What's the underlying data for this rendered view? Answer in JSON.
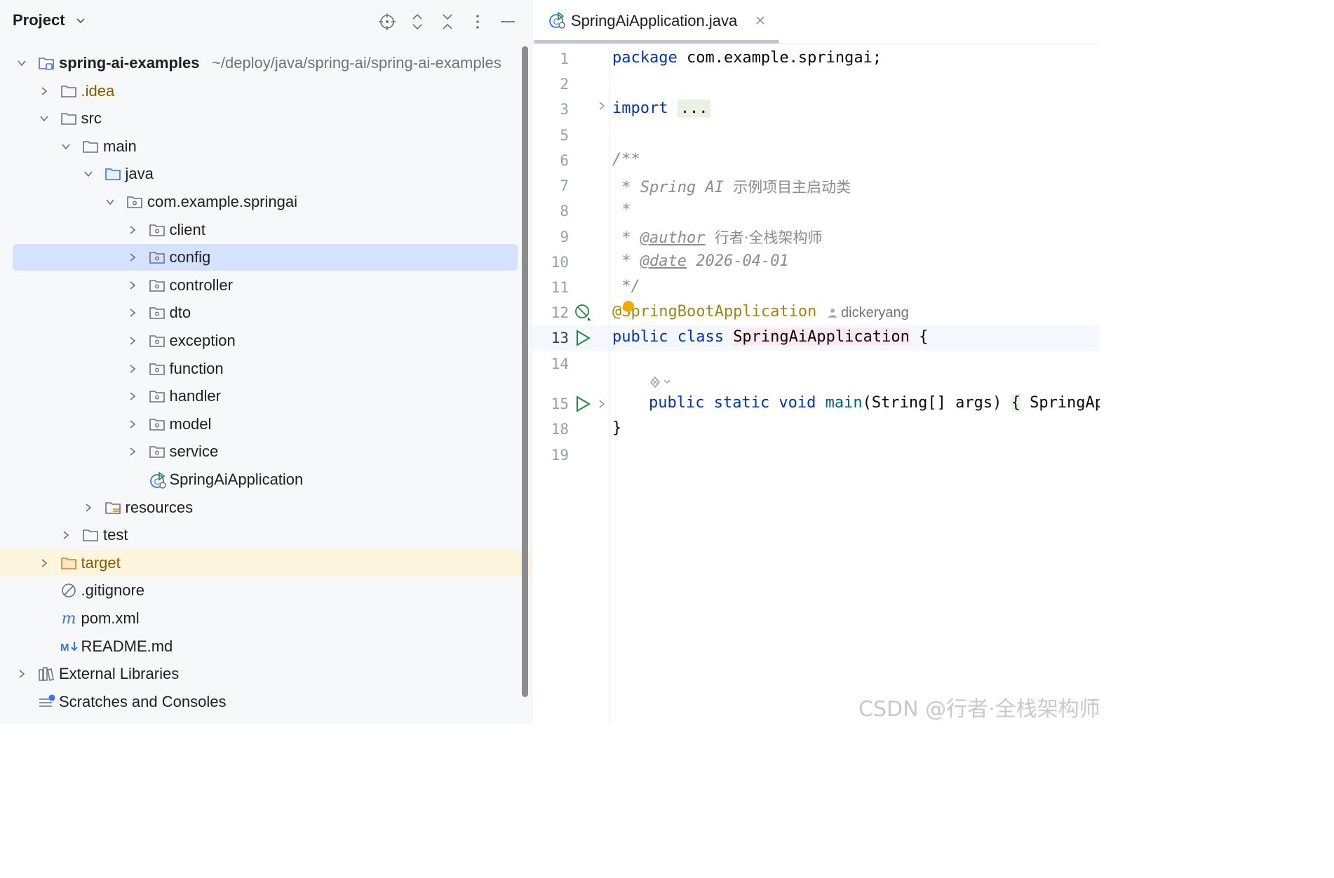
{
  "project_panel": {
    "title": "Project",
    "header_buttons": [
      "locate-icon",
      "expand-all-icon",
      "collapse-all-icon",
      "more-options-icon",
      "hide-panel-icon"
    ],
    "tree": [
      {
        "label": "spring-ai-examples",
        "path": "~/deploy/java/spring-ai/spring-ai-examples",
        "icon": "module-folder-icon",
        "expanded": true
      },
      {
        "label": ".idea",
        "icon": "folder-icon",
        "expanded": false
      },
      {
        "label": "src",
        "icon": "folder-icon",
        "expanded": true
      },
      {
        "label": "main",
        "icon": "folder-icon",
        "expanded": true
      },
      {
        "label": "java",
        "icon": "source-folder-icon",
        "expanded": true
      },
      {
        "label": "com.example.springai",
        "icon": "package-icon",
        "expanded": true
      },
      {
        "label": "client",
        "icon": "package-icon",
        "expanded": false
      },
      {
        "label": "config",
        "icon": "package-icon",
        "expanded": false,
        "selected": true
      },
      {
        "label": "controller",
        "icon": "package-icon",
        "expanded": false
      },
      {
        "label": "dto",
        "icon": "package-icon",
        "expanded": false
      },
      {
        "label": "exception",
        "icon": "package-icon",
        "expanded": false
      },
      {
        "label": "function",
        "icon": "package-icon",
        "expanded": false
      },
      {
        "label": "handler",
        "icon": "package-icon",
        "expanded": false
      },
      {
        "label": "model",
        "icon": "package-icon",
        "expanded": false
      },
      {
        "label": "service",
        "icon": "package-icon",
        "expanded": false
      },
      {
        "label": "SpringAiApplication",
        "icon": "spring-boot-class-icon"
      },
      {
        "label": "resources",
        "icon": "resources-folder-icon",
        "expanded": false
      },
      {
        "label": "test",
        "icon": "folder-icon",
        "expanded": false
      },
      {
        "label": "target",
        "icon": "excluded-folder-icon",
        "expanded": false,
        "highlighted": true
      },
      {
        "label": ".gitignore",
        "icon": "ignore-file-icon"
      },
      {
        "label": "pom.xml",
        "icon": "maven-icon"
      },
      {
        "label": "README.md",
        "icon": "markdown-icon"
      },
      {
        "label": "External Libraries",
        "icon": "libraries-icon",
        "expanded": false
      },
      {
        "label": "Scratches and Consoles",
        "icon": "scratches-icon"
      }
    ]
  },
  "editor": {
    "tab": {
      "label": "SpringAiApplication.java",
      "icon": "spring-boot-class-icon"
    },
    "current_line": 13,
    "line_numbers": [
      "1",
      "2",
      "3",
      "5",
      "6",
      "7",
      "8",
      "9",
      "10",
      "11",
      "12",
      "13",
      "14",
      "15",
      "18",
      "19"
    ],
    "code": {
      "l1_kw": "package",
      "l1_rest": " com.example.springai;",
      "l3_kw": "import",
      "l3_fold": "...",
      "l6": "/**",
      "l7_a": " * Spring AI ",
      "l7_b": "示例项目主启动类",
      "l8": " *",
      "l9_a": " * ",
      "l9_tag": "@author",
      "l9_b": "行者·全栈架构师",
      "l10_a": " * ",
      "l10_tag": "@date",
      "l10_b": " 2026-04-01",
      "l11": " */",
      "l12_ann": "@SpringBootApplication",
      "l12_author": "dickeryang",
      "l13_kw": "public class ",
      "l13_cls": "SpringAiApplication",
      "l13_rest": " {",
      "l15_kw": "public static void ",
      "l15_meth": "main",
      "l15_args": "(String[] args) ",
      "l15_brace": "{",
      "l15_rest": " SpringApp",
      "l18": "}"
    }
  },
  "watermark": "CSDN @行者·全栈架构师"
}
